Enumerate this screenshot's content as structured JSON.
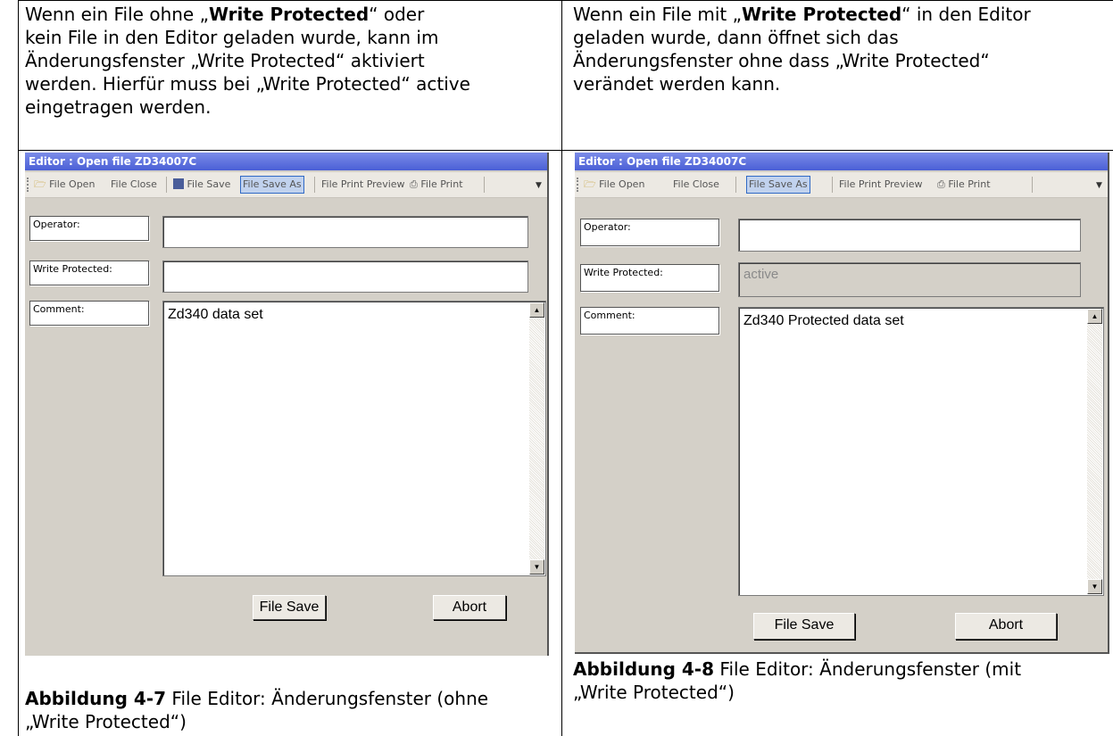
{
  "left": {
    "para_lines": [
      [
        "Wenn ein File ohne „",
        "Write Protected",
        "“ oder"
      ],
      [
        "kein File in den Editor geladen wurde, kann im"
      ],
      [
        "Änderungsfenster „Write Protected“ aktiviert"
      ],
      [
        "werden. Hierfür muss bei „Write Protected“ active"
      ],
      [
        "eingetragen werden."
      ]
    ],
    "window": {
      "title": "Editor : Open file ZD34007C",
      "toolbar": {
        "file_open": "File Open",
        "file_close": "File Close",
        "file_save": "File Save",
        "file_save_as": "File Save As",
        "file_print_preview": "File Print Preview",
        "file_print": "File Print"
      },
      "operator_label": "Operator:",
      "operator_value": "",
      "write_protected_label": "Write Protected:",
      "write_protected_value": "",
      "comment_label": "Comment:",
      "comment_value": "Zd340 data set",
      "save_button": "File Save",
      "abort_button": "Abort"
    },
    "caption_bold": "Abbildung 4-7",
    "caption_line1": "  File Editor: Änderungsfenster (ohne",
    "caption_line2": "„Write Protected“)"
  },
  "right": {
    "para_lines": [
      [
        "Wenn ein File mit „",
        "Write Protected",
        "“ in den Editor"
      ],
      [
        "geladen wurde, dann öffnet sich das"
      ],
      [
        "Änderungsfenster ohne dass „Write Protected“"
      ],
      [
        "verändet werden kann."
      ]
    ],
    "window": {
      "title": "Editor : Open file ZD34007C",
      "toolbar": {
        "file_open": "File Open",
        "file_close": "File Close",
        "file_save_as": "File Save As",
        "file_print_preview": "File Print Preview",
        "file_print": "File Print"
      },
      "operator_label": "Operator:",
      "operator_value": "",
      "write_protected_label": "Write Protected:",
      "write_protected_value": "active",
      "comment_label": "Comment:",
      "comment_value": "Zd340 Protected data set",
      "save_button": "File Save",
      "abort_button": "Abort"
    },
    "caption_bold": "Abbildung 4-8",
    "caption_line1": " File Editor: Änderungsfenster (mit",
    "caption_line2": "„Write Protected“)"
  }
}
